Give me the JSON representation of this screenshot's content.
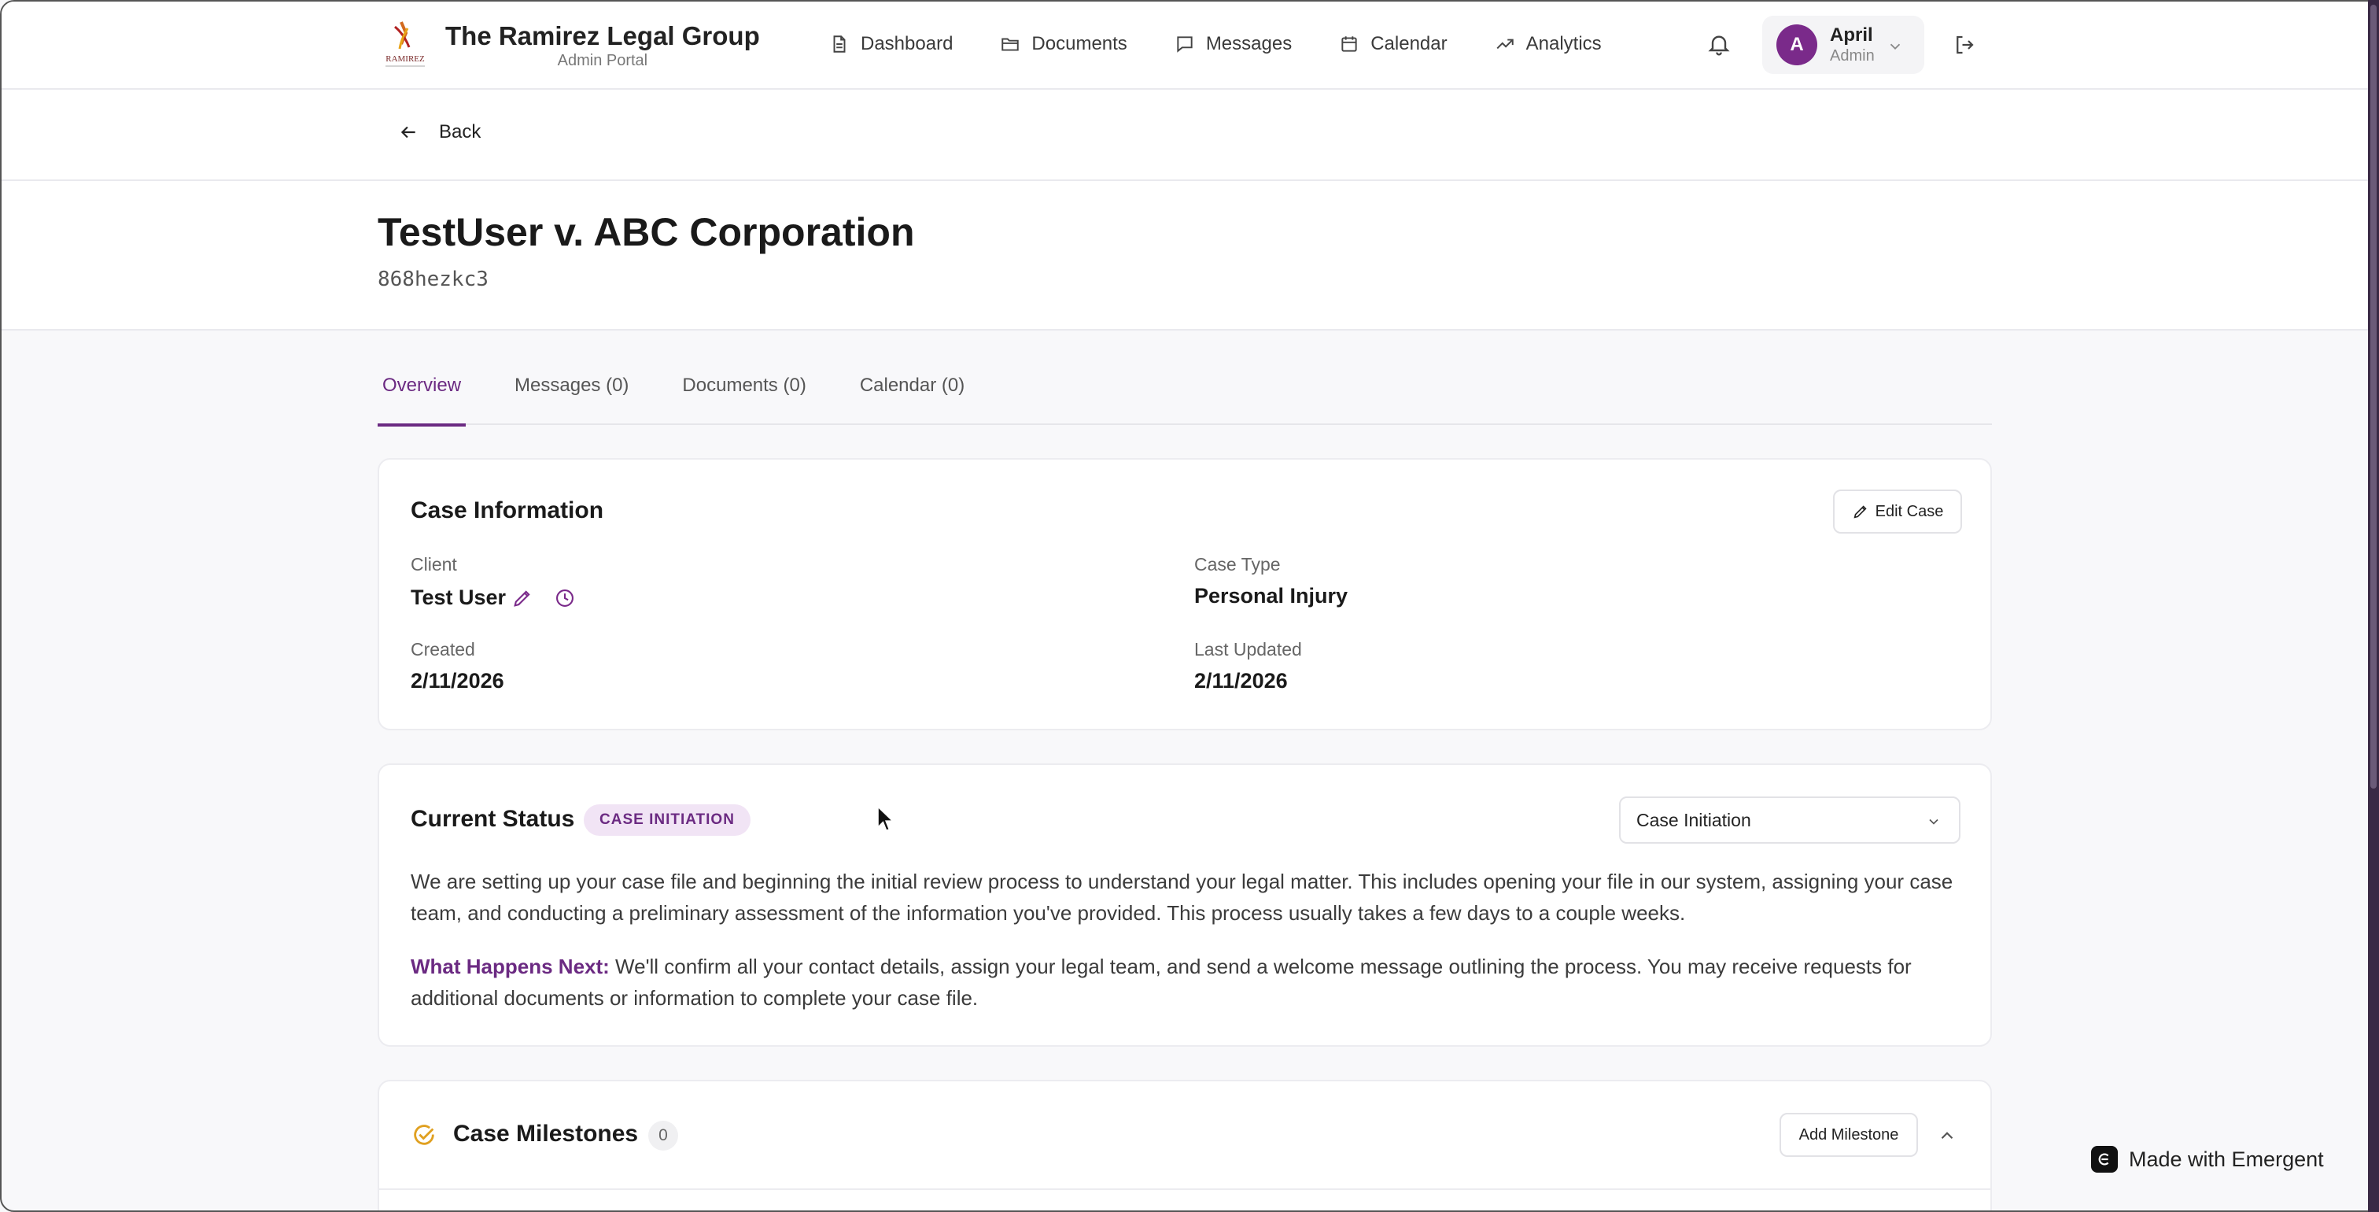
{
  "brand": {
    "title": "The Ramirez Legal Group",
    "subtitle": "Admin Portal",
    "logo_text": "RAMIREZ"
  },
  "nav": {
    "items": [
      {
        "label": "Dashboard",
        "icon": "file-text-icon"
      },
      {
        "label": "Documents",
        "icon": "folder-icon"
      },
      {
        "label": "Messages",
        "icon": "message-icon"
      },
      {
        "label": "Calendar",
        "icon": "calendar-icon"
      },
      {
        "label": "Analytics",
        "icon": "trending-up-icon"
      }
    ]
  },
  "user": {
    "initial": "A",
    "name": "April",
    "role": "Admin"
  },
  "back": {
    "label": "Back"
  },
  "case": {
    "title": "TestUser v. ABC Corporation",
    "id": "868hezkc3"
  },
  "tabs": [
    {
      "label": "Overview",
      "active": true
    },
    {
      "label": "Messages (0)",
      "active": false
    },
    {
      "label": "Documents (0)",
      "active": false
    },
    {
      "label": "Calendar (0)",
      "active": false
    }
  ],
  "case_info": {
    "heading": "Case Information",
    "edit_label": "Edit Case",
    "client_label": "Client",
    "client_value": "Test User",
    "case_type_label": "Case Type",
    "case_type_value": "Personal Injury",
    "created_label": "Created",
    "created_value": "2/11/2026",
    "updated_label": "Last Updated",
    "updated_value": "2/11/2026"
  },
  "status": {
    "heading": "Current Status",
    "badge": "CASE INITIATION",
    "selected": "Case Initiation",
    "description": "We are setting up your case file and beginning the initial review process to understand your legal matter. This includes opening your file in our system, assigning your case team, and conducting a preliminary assessment of the information you've provided. This process usually takes a few days to a couple weeks.",
    "next_label": "What Happens Next:",
    "next_text": " We'll confirm all your contact details, assign your legal team, and send a welcome message outlining the process. You may receive requests for additional documents or information to complete your case file."
  },
  "milestones": {
    "heading": "Case Milestones",
    "count": "0",
    "add_label": "Add Milestone"
  },
  "footer": {
    "made_with": "Made with Emergent"
  },
  "colors": {
    "accent": "#6b2a82",
    "milestone_icon": "#e0a020"
  }
}
